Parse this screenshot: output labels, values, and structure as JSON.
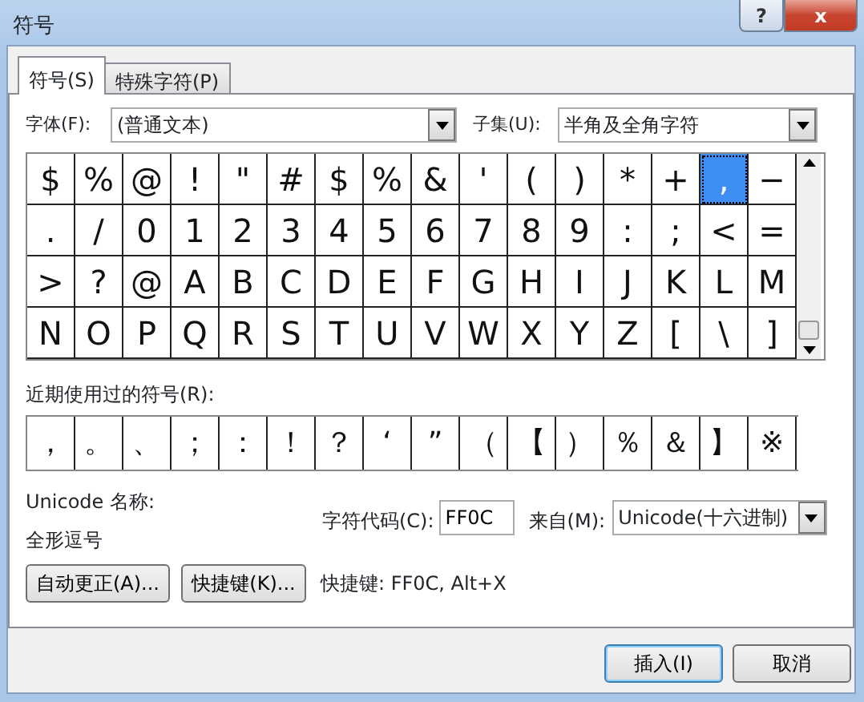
{
  "window": {
    "title": "符号"
  },
  "title_buttons": [
    {
      "kind": "help",
      "label": "?"
    },
    {
      "kind": "close",
      "label": "x"
    }
  ],
  "tabs": [
    {
      "label": "符号(S)",
      "selected": true
    },
    {
      "label": "特殊字符(P)",
      "selected": false
    }
  ],
  "font": {
    "label": "字体(F):",
    "value": "(普通文本)"
  },
  "subset": {
    "label": "子集(U):",
    "value": "半角及全角字符"
  },
  "symbols": [
    [
      {
        "char": "$",
        "selected": false
      },
      {
        "char": "%",
        "selected": false
      },
      {
        "char": "@",
        "selected": false
      },
      {
        "char": "!",
        "selected": false
      },
      {
        "char": "\"",
        "selected": false
      },
      {
        "char": "#",
        "selected": false
      },
      {
        "char": "$",
        "selected": false
      },
      {
        "char": "%",
        "selected": false
      },
      {
        "char": "&",
        "selected": false
      },
      {
        "char": "'",
        "selected": false
      },
      {
        "char": "(",
        "selected": false
      },
      {
        "char": ")",
        "selected": false
      },
      {
        "char": "*",
        "selected": false
      },
      {
        "char": "+",
        "selected": false
      },
      {
        "char": ",",
        "selected": true
      },
      {
        "char": "−",
        "selected": false
      }
    ],
    [
      {
        "char": ".",
        "selected": false
      },
      {
        "char": "/",
        "selected": false
      },
      {
        "char": "0",
        "selected": false
      },
      {
        "char": "1",
        "selected": false
      },
      {
        "char": "2",
        "selected": false
      },
      {
        "char": "3",
        "selected": false
      },
      {
        "char": "4",
        "selected": false
      },
      {
        "char": "5",
        "selected": false
      },
      {
        "char": "6",
        "selected": false
      },
      {
        "char": "7",
        "selected": false
      },
      {
        "char": "8",
        "selected": false
      },
      {
        "char": "9",
        "selected": false
      },
      {
        "char": ":",
        "selected": false
      },
      {
        "char": ";",
        "selected": false
      },
      {
        "char": "<",
        "selected": false
      },
      {
        "char": "=",
        "selected": false
      }
    ],
    [
      {
        "char": ">",
        "selected": false
      },
      {
        "char": "?",
        "selected": false
      },
      {
        "char": "@",
        "selected": false
      },
      {
        "char": "A",
        "selected": false
      },
      {
        "char": "B",
        "selected": false
      },
      {
        "char": "C",
        "selected": false
      },
      {
        "char": "D",
        "selected": false
      },
      {
        "char": "E",
        "selected": false
      },
      {
        "char": "F",
        "selected": false
      },
      {
        "char": "G",
        "selected": false
      },
      {
        "char": "H",
        "selected": false
      },
      {
        "char": "I",
        "selected": false
      },
      {
        "char": "J",
        "selected": false
      },
      {
        "char": "K",
        "selected": false
      },
      {
        "char": "L",
        "selected": false
      },
      {
        "char": "M",
        "selected": false
      }
    ],
    [
      {
        "char": "N",
        "selected": false
      },
      {
        "char": "O",
        "selected": false
      },
      {
        "char": "P",
        "selected": false
      },
      {
        "char": "Q",
        "selected": false
      },
      {
        "char": "R",
        "selected": false
      },
      {
        "char": "S",
        "selected": false
      },
      {
        "char": "T",
        "selected": false
      },
      {
        "char": "U",
        "selected": false
      },
      {
        "char": "V",
        "selected": false
      },
      {
        "char": "W",
        "selected": false
      },
      {
        "char": "X",
        "selected": false
      },
      {
        "char": "Y",
        "selected": false
      },
      {
        "char": "Z",
        "selected": false
      },
      {
        "char": "[",
        "selected": false
      },
      {
        "char": "\\",
        "selected": false
      },
      {
        "char": "]",
        "selected": false
      }
    ]
  ],
  "recent": {
    "label": "近期使用过的符号(R):",
    "chars": [
      "，",
      "。",
      "、",
      "；",
      "：",
      "！",
      "？",
      "‘",
      "”",
      "（",
      "【",
      "）",
      "％",
      "＆",
      "】",
      "※"
    ]
  },
  "unicode_name": {
    "label": "Unicode 名称:",
    "value": "全形逗号"
  },
  "char_code": {
    "label": "字符代码(C):",
    "value": "FF0C"
  },
  "from": {
    "label": "来自(M):",
    "value": "Unicode(十六进制)"
  },
  "tool_buttons": [
    "自动更正(A)...",
    "快捷键(K)..."
  ],
  "shortcut": "快捷键: FF0C, Alt+X",
  "dialog_buttons": [
    {
      "label": "插入(I)",
      "default": true
    },
    {
      "label": "取消",
      "default": false
    }
  ]
}
